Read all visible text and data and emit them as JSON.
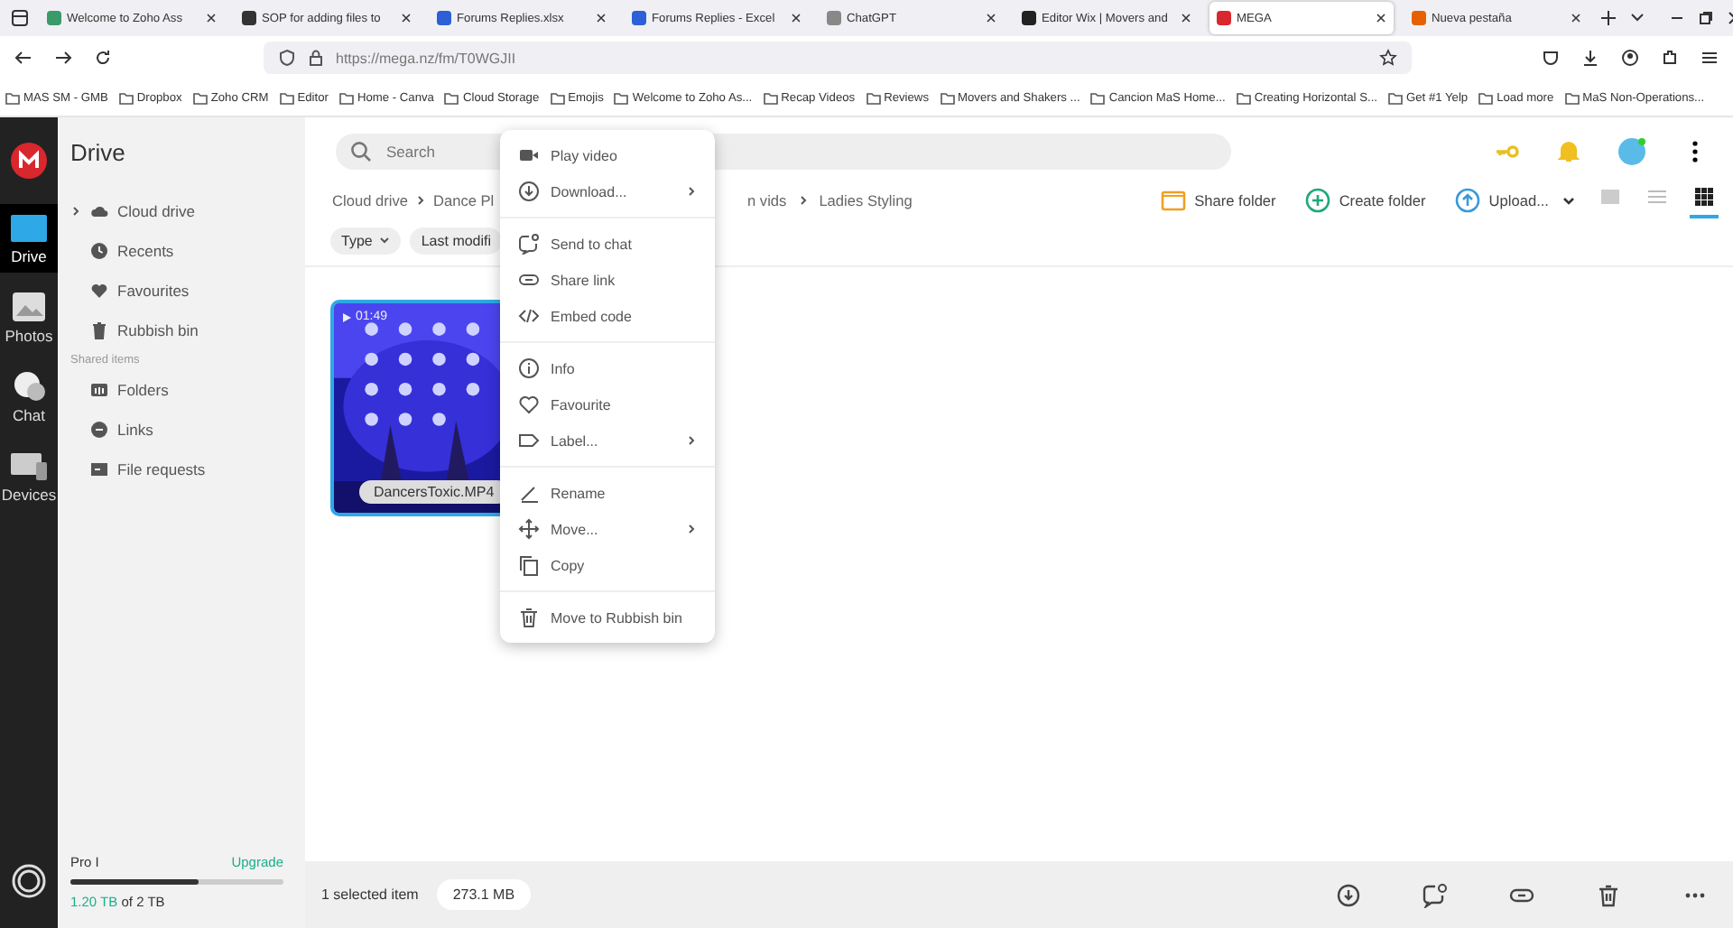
{
  "browser": {
    "tabs": [
      {
        "title": "Welcome to Zoho Ass",
        "selected": false
      },
      {
        "title": "SOP for adding files to",
        "selected": false
      },
      {
        "title": "Forums Replies.xlsx",
        "selected": false
      },
      {
        "title": "Forums Replies - Excel",
        "selected": false
      },
      {
        "title": "ChatGPT",
        "selected": false
      },
      {
        "title": "Editor Wix | Movers and",
        "selected": false
      },
      {
        "title": "MEGA",
        "selected": true
      },
      {
        "title": "Nueva pestaña",
        "selected": false
      }
    ],
    "url": "https://mega.nz/fm/T0WGJII",
    "bookmarks": [
      "MAS SM - GMB",
      "Dropbox",
      "Zoho CRM",
      "Editor",
      "Home - Canva",
      "Cloud Storage",
      "Emojis",
      "Welcome to Zoho As...",
      "Recap Videos",
      "Reviews",
      "Movers and Shakers ...",
      "Cancion MaS Home...",
      "Creating Horizontal S...",
      "Get #1 Yelp",
      "Load more",
      "MaS Non-Operations..."
    ]
  },
  "rail": [
    {
      "label": "Drive",
      "selected": true
    },
    {
      "label": "Photos",
      "selected": false
    },
    {
      "label": "Chat",
      "selected": false
    },
    {
      "label": "Devices",
      "selected": false
    }
  ],
  "sidebar": {
    "title": "Drive",
    "items": [
      {
        "label": "Cloud drive",
        "kind": "cloud",
        "expandable": true
      },
      {
        "label": "Recents",
        "kind": "clock",
        "expandable": false
      },
      {
        "label": "Favourites",
        "kind": "heart",
        "expandable": false
      },
      {
        "label": "Rubbish bin",
        "kind": "bin",
        "expandable": false
      }
    ],
    "shared_heading": "Shared items",
    "shared": [
      {
        "label": "Folders",
        "kind": "folders"
      },
      {
        "label": "Links",
        "kind": "link"
      },
      {
        "label": "File requests",
        "kind": "request"
      }
    ],
    "plan": "Pro I",
    "upgrade": "Upgrade",
    "storage": {
      "level": 0.6,
      "used": "1.20 TB",
      "total": "of 2 TB"
    }
  },
  "search": {
    "placeholder": "Search"
  },
  "breadcrumb": [
    "Cloud drive",
    "Dance Pl",
    "n vids",
    "Ladies Styling"
  ],
  "actions": [
    "Share folder",
    "Create folder",
    "Upload..."
  ],
  "views": [
    {
      "kind": "thumb",
      "selected": false
    },
    {
      "kind": "list",
      "selected": false
    },
    {
      "kind": "grid",
      "selected": true
    }
  ],
  "filters": [
    "Type",
    "Last modifi"
  ],
  "files": [
    {
      "name": "DancersToxic.MP4",
      "duration": "01:49",
      "selected": true
    }
  ],
  "menu": [
    [
      {
        "label": "Play video",
        "kind": "video",
        "submenu": false
      },
      {
        "label": "Download...",
        "kind": "download",
        "submenu": true
      }
    ],
    [
      {
        "label": "Send to chat",
        "kind": "chat",
        "submenu": false
      },
      {
        "label": "Share link",
        "kind": "link",
        "submenu": false
      },
      {
        "label": "Embed code",
        "kind": "code",
        "submenu": false
      }
    ],
    [
      {
        "label": "Info",
        "kind": "info",
        "submenu": false
      },
      {
        "label": "Favourite",
        "kind": "heart",
        "submenu": false
      },
      {
        "label": "Label...",
        "kind": "label",
        "submenu": true
      }
    ],
    [
      {
        "label": "Rename",
        "kind": "rename",
        "submenu": false
      },
      {
        "label": "Move...",
        "kind": "move",
        "submenu": true
      },
      {
        "label": "Copy",
        "kind": "copy",
        "submenu": false
      }
    ],
    [
      {
        "label": "Move to Rubbish bin",
        "kind": "bin",
        "submenu": false
      }
    ]
  ],
  "status": {
    "selected": "1 selected item",
    "size": "273.1 MB"
  }
}
